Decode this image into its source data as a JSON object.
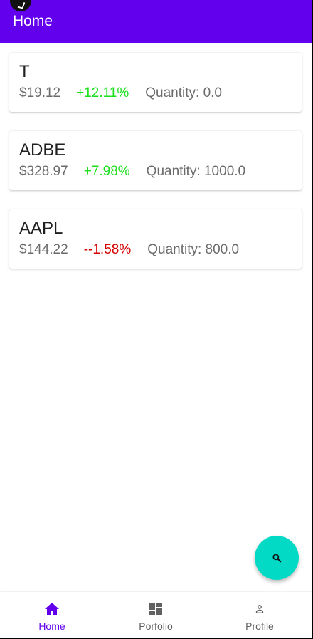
{
  "app_bar": {
    "title": "Home"
  },
  "stocks": [
    {
      "symbol": "T",
      "price": "$19.12",
      "change": "+12.11%",
      "direction": "up",
      "quantity": "Quantity: 0.0"
    },
    {
      "symbol": "ADBE",
      "price": "$328.97",
      "change": "+7.98%",
      "direction": "up",
      "quantity": "Quantity: 1000.0"
    },
    {
      "symbol": "AAPL",
      "price": "$144.22",
      "change": "--1.58%",
      "direction": "down",
      "quantity": "Quantity: 800.0"
    }
  ],
  "fab": {
    "icon": "search-icon"
  },
  "bottom_nav": {
    "items": [
      {
        "label": "Home",
        "icon": "home-icon",
        "active": true
      },
      {
        "label": "Porfolio",
        "icon": "dashboard-icon",
        "active": false
      },
      {
        "label": "Profile",
        "icon": "person-icon",
        "active": false
      }
    ]
  },
  "colors": {
    "primary": "#6200ee",
    "accent": "#03dac5",
    "positive": "#1bdf1b",
    "negative": "#d50000"
  }
}
